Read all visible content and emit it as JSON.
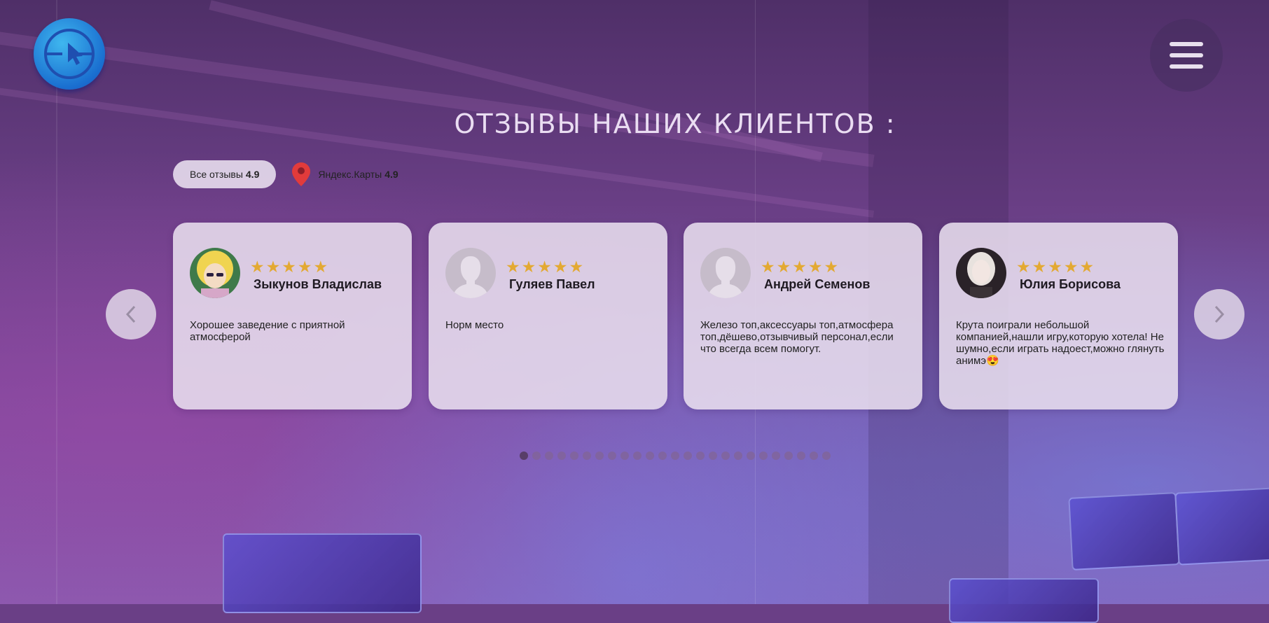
{
  "header": {
    "logo_icon": "cursor-target-icon",
    "menu_icon": "hamburger-menu-icon"
  },
  "section": {
    "title": "ОТЗЫВЫ НАШИХ КЛИЕНТОВ :"
  },
  "summary": {
    "all_reviews_label": "Все отзывы",
    "all_reviews_rating": "4.9",
    "yandex_label": "Яндекс.Карты",
    "yandex_rating": "4.9",
    "yandex_icon": "map-pin-icon"
  },
  "reviews": [
    {
      "name": "Зыкунов Владислав",
      "rating": 5,
      "text": "Хорошее заведение с приятной атмосферой",
      "avatar": "anime-girl-avatar"
    },
    {
      "name": "Гуляев Павел",
      "rating": 5,
      "text": "Норм место",
      "avatar": "placeholder-person-avatar"
    },
    {
      "name": "Андрей Семенов",
      "rating": 5,
      "text": "Железо топ,аксессуары топ,атмосфера топ,дёшево,отзывчивый персонал,если что всегда всем помогут.",
      "avatar": "placeholder-person-avatar"
    },
    {
      "name": "Юлия Борисова",
      "rating": 5,
      "text": "Крута поиграли небольшой компанией,нашли игру,которую хотела! Не шумно,если играть надоест,можно глянуть анимэ😍",
      "avatar": "photo-avatar"
    }
  ],
  "carousel": {
    "prev_icon": "chevron-left-icon",
    "next_icon": "chevron-right-icon",
    "total_pages": 25,
    "active_page": 1
  },
  "colors": {
    "star": "#e3a932",
    "pin": "#e23b3b",
    "card_bg": "#e8deee"
  }
}
